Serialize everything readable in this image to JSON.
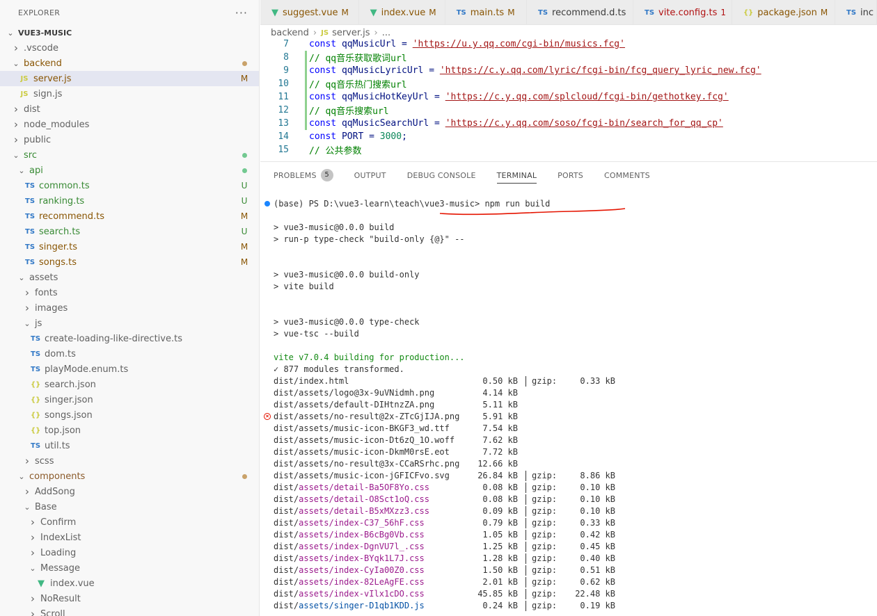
{
  "explorer": {
    "title": "EXPLORER",
    "more": "···",
    "items": [
      {
        "label": "VUE3-MUSIC",
        "depth": 0,
        "kind": "root",
        "expanded": true
      },
      {
        "label": ".vscode",
        "depth": 1,
        "kind": "folder",
        "expanded": false
      },
      {
        "label": "backend",
        "depth": 1,
        "kind": "folder",
        "expanded": true,
        "color": "brown",
        "dot": "brown"
      },
      {
        "label": "server.js",
        "depth": 2,
        "kind": "js",
        "color": "brown",
        "status": "M",
        "selected": true
      },
      {
        "label": "sign.js",
        "depth": 2,
        "kind": "js"
      },
      {
        "label": "dist",
        "depth": 1,
        "kind": "folder",
        "expanded": false
      },
      {
        "label": "node_modules",
        "depth": 1,
        "kind": "folder",
        "expanded": false
      },
      {
        "label": "public",
        "depth": 1,
        "kind": "folder",
        "expanded": false
      },
      {
        "label": "src",
        "depth": 1,
        "kind": "folder",
        "expanded": true,
        "color": "green",
        "dot": "green"
      },
      {
        "label": "api",
        "depth": 2,
        "kind": "folder",
        "expanded": true,
        "color": "green",
        "dot": "green"
      },
      {
        "label": "common.ts",
        "depth": 3,
        "kind": "ts",
        "color": "green",
        "status": "U"
      },
      {
        "label": "ranking.ts",
        "depth": 3,
        "kind": "ts",
        "color": "green",
        "status": "U"
      },
      {
        "label": "recommend.ts",
        "depth": 3,
        "kind": "ts",
        "color": "brown",
        "status": "M"
      },
      {
        "label": "search.ts",
        "depth": 3,
        "kind": "ts",
        "color": "green",
        "status": "U"
      },
      {
        "label": "singer.ts",
        "depth": 3,
        "kind": "ts",
        "color": "brown",
        "status": "M"
      },
      {
        "label": "songs.ts",
        "depth": 3,
        "kind": "ts",
        "color": "brown",
        "status": "M"
      },
      {
        "label": "assets",
        "depth": 2,
        "kind": "folder",
        "expanded": true
      },
      {
        "label": "fonts",
        "depth": 3,
        "kind": "folder",
        "expanded": false
      },
      {
        "label": "images",
        "depth": 3,
        "kind": "folder",
        "expanded": false
      },
      {
        "label": "js",
        "depth": 3,
        "kind": "folder",
        "expanded": true
      },
      {
        "label": "create-loading-like-directive.ts",
        "depth": 4,
        "kind": "ts"
      },
      {
        "label": "dom.ts",
        "depth": 4,
        "kind": "ts"
      },
      {
        "label": "playMode.enum.ts",
        "depth": 4,
        "kind": "ts"
      },
      {
        "label": "search.json",
        "depth": 4,
        "kind": "json"
      },
      {
        "label": "singer.json",
        "depth": 4,
        "kind": "json"
      },
      {
        "label": "songs.json",
        "depth": 4,
        "kind": "json"
      },
      {
        "label": "top.json",
        "depth": 4,
        "kind": "json"
      },
      {
        "label": "util.ts",
        "depth": 4,
        "kind": "ts"
      },
      {
        "label": "scss",
        "depth": 3,
        "kind": "folder",
        "expanded": false
      },
      {
        "label": "components",
        "depth": 2,
        "kind": "folder",
        "expanded": true,
        "color": "brownish",
        "dot": "brown"
      },
      {
        "label": "AddSong",
        "depth": 3,
        "kind": "folder",
        "expanded": false
      },
      {
        "label": "Base",
        "depth": 3,
        "kind": "folder",
        "expanded": true
      },
      {
        "label": "Confirm",
        "depth": 4,
        "kind": "folder",
        "expanded": false
      },
      {
        "label": "IndexList",
        "depth": 4,
        "kind": "folder",
        "expanded": false
      },
      {
        "label": "Loading",
        "depth": 4,
        "kind": "folder",
        "expanded": false
      },
      {
        "label": "Message",
        "depth": 4,
        "kind": "folder",
        "expanded": true
      },
      {
        "label": "index.vue",
        "depth": 5,
        "kind": "vue"
      },
      {
        "label": "NoResult",
        "depth": 4,
        "kind": "folder",
        "expanded": false
      },
      {
        "label": "Scroll",
        "depth": 4,
        "kind": "folder",
        "expanded": false
      }
    ]
  },
  "tabs": [
    {
      "label": "suggest.vue",
      "kind": "vue",
      "status": "M",
      "style": "mod",
      "width": 145
    },
    {
      "label": "index.vue",
      "kind": "vue",
      "status": "M",
      "style": "mod",
      "width": 127
    },
    {
      "label": "main.ts",
      "kind": "ts",
      "status": "M",
      "style": "mod",
      "width": 120
    },
    {
      "label": "recommend.d.ts",
      "kind": "ts",
      "status": "",
      "style": "",
      "width": 153
    },
    {
      "label": "vite.config.ts",
      "kind": "ts",
      "status": "1",
      "style": "err",
      "width": 142
    },
    {
      "label": "package.json",
      "kind": "json",
      "status": "M",
      "style": "mod",
      "width": 148
    },
    {
      "label": "inc",
      "kind": "ts",
      "status": "",
      "style": "",
      "width": 60
    }
  ],
  "breadcrumb": {
    "folder": "backend",
    "file": "server.js",
    "rest": "..."
  },
  "editor": {
    "lines": [
      {
        "n": "7",
        "git": false,
        "tokens": [
          [
            "kw",
            "const "
          ],
          [
            "",
            "qqMusicUrl = "
          ],
          [
            "url",
            "'https://u.y.qq.com/cgi-bin/musics.fcg'"
          ]
        ]
      },
      {
        "n": "8",
        "git": true,
        "tokens": [
          [
            "cmt",
            "// qq音乐获取歌词url"
          ]
        ]
      },
      {
        "n": "9",
        "git": true,
        "tokens": [
          [
            "kw",
            "const "
          ],
          [
            "",
            "qqMusicLyricUrl = "
          ],
          [
            "url",
            "'https://c.y.qq.com/lyric/fcgi-bin/fcg_query_lyric_new.fcg'"
          ]
        ]
      },
      {
        "n": "10",
        "git": true,
        "tokens": [
          [
            "cmt",
            "// qq音乐热门搜索url"
          ]
        ]
      },
      {
        "n": "11",
        "git": true,
        "tokens": [
          [
            "kw",
            "const "
          ],
          [
            "",
            "qqMusicHotKeyUrl = "
          ],
          [
            "url",
            "'https://c.y.qq.com/splcloud/fcgi-bin/gethotkey.fcg'"
          ]
        ]
      },
      {
        "n": "12",
        "git": true,
        "tokens": [
          [
            "cmt",
            "// qq音乐搜索url"
          ]
        ]
      },
      {
        "n": "13",
        "git": true,
        "tokens": [
          [
            "kw",
            "const "
          ],
          [
            "",
            "qqMusicSearchUrl = "
          ],
          [
            "url",
            "'https://c.y.qq.com/soso/fcgi-bin/search_for_qq_cp'"
          ]
        ]
      },
      {
        "n": "14",
        "git": false,
        "tokens": [
          [
            "kw",
            "const "
          ],
          [
            "",
            "PORT = "
          ],
          [
            "num",
            "3000"
          ],
          [
            "",
            ";"
          ]
        ]
      },
      {
        "n": "15",
        "git": false,
        "tokens": [
          [
            "cmt",
            "// 公共参数"
          ]
        ]
      }
    ]
  },
  "panel": {
    "tabs": [
      {
        "label": "PROBLEMS",
        "badge": "5",
        "active": false
      },
      {
        "label": "OUTPUT",
        "active": false
      },
      {
        "label": "DEBUG CONSOLE",
        "active": false
      },
      {
        "label": "TERMINAL",
        "active": true
      },
      {
        "label": "PORTS",
        "active": false
      },
      {
        "label": "COMMENTS",
        "active": false
      }
    ]
  },
  "terminal": {
    "prompt": "(base) PS D:\\vue3-learn\\teach\\vue3-music> ",
    "command": "npm run build",
    "lines": [
      "> vue3-music@0.0.0 build",
      "> run-p type-check \"build-only {@}\" --",
      "> vue3-music@0.0.0 build-only",
      "> vite build",
      "> vue3-music@0.0.0 type-check",
      "> vue-tsc --build"
    ],
    "vite_line": "vite v7.0.4 building for production...",
    "modules_line": "✓ 877 modules transformed.",
    "files": [
      {
        "dir": "dist/",
        "name": "index.html",
        "color": "",
        "size": "0.50 kB",
        "gzip": "0.33 kB"
      },
      {
        "dir": "dist/",
        "name": "assets/logo@3x-9uVNidmh.png",
        "color": "",
        "size": "4.14 kB",
        "gzip": ""
      },
      {
        "dir": "dist/",
        "name": "assets/default-DIHtnzZA.png",
        "color": "",
        "size": "5.11 kB",
        "gzip": ""
      },
      {
        "dir": "dist/",
        "name": "assets/no-result@2x-ZTcGjIJA.png",
        "color": "",
        "size": "5.91 kB",
        "gzip": "",
        "err": true
      },
      {
        "dir": "dist/",
        "name": "assets/music-icon-BKGF3_wd.ttf",
        "color": "",
        "size": "7.54 kB",
        "gzip": ""
      },
      {
        "dir": "dist/",
        "name": "assets/music-icon-Dt6zQ_1O.woff",
        "color": "",
        "size": "7.62 kB",
        "gzip": ""
      },
      {
        "dir": "dist/",
        "name": "assets/music-icon-DkmM0rsE.eot",
        "color": "",
        "size": "7.72 kB",
        "gzip": ""
      },
      {
        "dir": "dist/",
        "name": "assets/no-result@3x-CCaRSrhc.png",
        "color": "",
        "size": "12.66 kB",
        "gzip": ""
      },
      {
        "dir": "dist/",
        "name": "assets/music-icon-jGFICFvo.svg",
        "color": "",
        "size": "26.84 kB",
        "gzip": "8.86 kB"
      },
      {
        "dir": "dist/",
        "name": "assets/detail-Ba5OF8Yo.css",
        "color": "pink",
        "size": "0.08 kB",
        "gzip": "0.10 kB"
      },
      {
        "dir": "dist/",
        "name": "assets/detail-O8Sct1oQ.css",
        "color": "pink",
        "size": "0.08 kB",
        "gzip": "0.10 kB"
      },
      {
        "dir": "dist/",
        "name": "assets/detail-B5xMXzz3.css",
        "color": "pink",
        "size": "0.09 kB",
        "gzip": "0.10 kB"
      },
      {
        "dir": "dist/",
        "name": "assets/index-C37_56hF.css",
        "color": "pink",
        "size": "0.79 kB",
        "gzip": "0.33 kB"
      },
      {
        "dir": "dist/",
        "name": "assets/index-B6cBg0Vb.css",
        "color": "pink",
        "size": "1.05 kB",
        "gzip": "0.42 kB"
      },
      {
        "dir": "dist/",
        "name": "assets/index-DgnVU7l_.css",
        "color": "pink",
        "size": "1.25 kB",
        "gzip": "0.45 kB"
      },
      {
        "dir": "dist/",
        "name": "assets/index-BYqk1L7J.css",
        "color": "pink",
        "size": "1.28 kB",
        "gzip": "0.40 kB"
      },
      {
        "dir": "dist/",
        "name": "assets/index-CyIa00Z0.css",
        "color": "pink",
        "size": "1.50 kB",
        "gzip": "0.51 kB"
      },
      {
        "dir": "dist/",
        "name": "assets/index-82LeAgFE.css",
        "color": "pink",
        "size": "2.01 kB",
        "gzip": "0.62 kB"
      },
      {
        "dir": "dist/",
        "name": "assets/index-vIlx1cDO.css",
        "color": "pink",
        "size": "45.85 kB",
        "gzip": "22.48 kB"
      },
      {
        "dir": "dist/",
        "name": "assets/singer-D1qb1KDD.js",
        "color": "blue",
        "size": "0.24 kB",
        "gzip": "0.19 kB"
      }
    ],
    "gzip_label": "gzip:"
  },
  "colors": {
    "accent": "#007acc",
    "modified": "#895503",
    "untracked": "#388a34",
    "annotation": "#e51400"
  }
}
